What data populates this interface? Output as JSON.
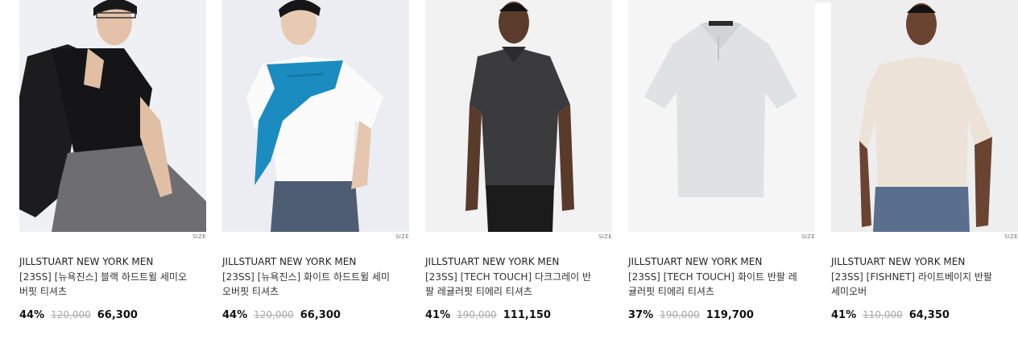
{
  "products": [
    {
      "brand": "JILLSTUART NEW YORK MEN",
      "name": "[23SS] [뉴욕진스] 블랙 하드트윌 세미오버핏 티셔츠",
      "size_label": "SIZE",
      "discount": "44%",
      "original_price": "120,000",
      "sale_price": "66,300",
      "image": "model in black t-shirt with black jacket"
    },
    {
      "brand": "JILLSTUART NEW YORK MEN",
      "name": "[23SS] [뉴욕진스] 화이트 하드트윌 세미오버핏 티셔츠",
      "size_label": "SIZE",
      "discount": "44%",
      "original_price": "120,000",
      "sale_price": "66,300",
      "image": "model in white t-shirt with blue sweater over shoulders"
    },
    {
      "brand": "JILLSTUART NEW YORK MEN",
      "name": "[23SS] [TECH TOUCH] 다크그레이 반팔 레귤러핏 티에리 티셔츠",
      "size_label": "SIZE",
      "discount": "41%",
      "original_price": "190,000",
      "sale_price": "111,150",
      "image": "model in dark grey polo shirt"
    },
    {
      "brand": "JILLSTUART NEW YORK MEN",
      "name": "[23SS] [TECH TOUCH] 화이트 반팔 레귤러핏 티에리 티셔츠",
      "size_label": "SIZE",
      "discount": "37%",
      "original_price": "190,000",
      "sale_price": "119,700",
      "image": "flat white polo shirt"
    },
    {
      "brand": "JILLSTUART NEW YORK MEN",
      "name": "[23SS] [FISHNET] 라이트베이지 반팔 세미오버",
      "size_label": "SIZE",
      "discount": "41%",
      "original_price": "110,000",
      "sale_price": "64,350",
      "image": "model in light beige t-shirt"
    }
  ]
}
